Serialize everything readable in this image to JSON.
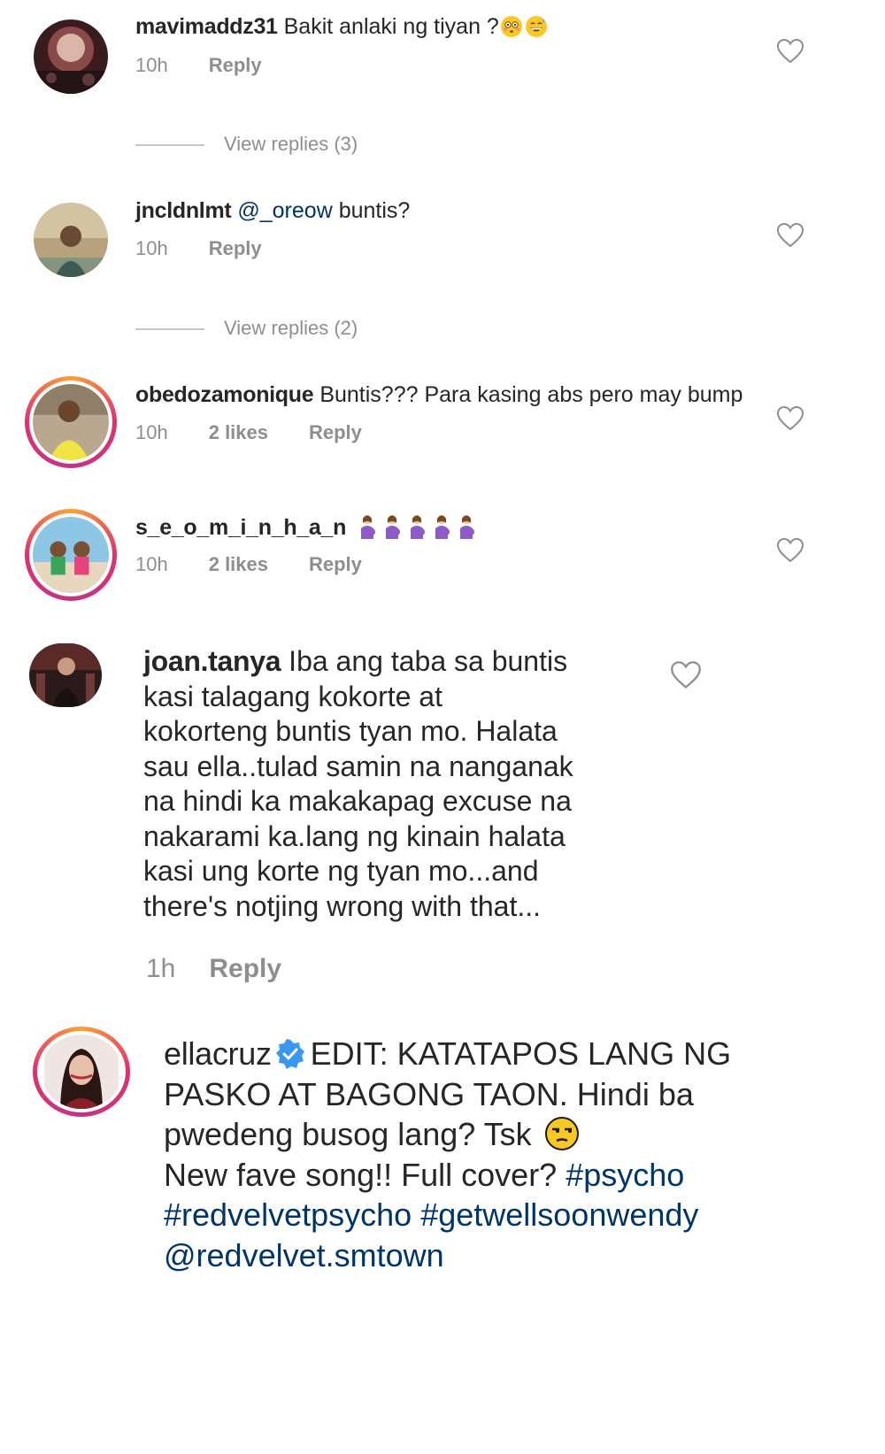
{
  "comments": [
    {
      "username": "mavimaddz31",
      "text": "Bakit anlaki ng tiyan ?",
      "emojis": [
        "flushed-face-emoji",
        "grinning-sweat-emoji"
      ],
      "time": "10h",
      "reply_label": "Reply",
      "view_replies": "View replies (3)"
    },
    {
      "username": "jncldnlmt",
      "mention": "@_oreow",
      "text": "buntis?",
      "time": "10h",
      "reply_label": "Reply",
      "view_replies": "View replies (2)"
    },
    {
      "username": "obedozamonique",
      "text": "Buntis??? Para kasing abs pero may bump",
      "time": "10h",
      "likes": "2 likes",
      "reply_label": "Reply"
    },
    {
      "username": "s_e_o_m_i_n_h_a_n",
      "emojis": [
        "pregnant-woman-emoji",
        "pregnant-woman-emoji",
        "pregnant-woman-emoji",
        "pregnant-woman-emoji",
        "pregnant-woman-emoji"
      ],
      "time": "10h",
      "likes": "2 likes",
      "reply_label": "Reply"
    },
    {
      "username": "joan.tanya",
      "lines": [
        "Iba ang taba sa buntis",
        "kasi talagang kokorte at",
        "kokorteng buntis tyan mo. Halata",
        "sau ella..tulad samin na nanganak",
        "na hindi ka makakapag excuse na",
        "nakarami ka.lang ng kinain halata",
        "kasi ung korte ng tyan mo...and",
        "there's notjing wrong with that..."
      ],
      "time": "1h",
      "reply_label": "Reply"
    }
  ],
  "caption": {
    "username": "ellacruz",
    "verified_icon": "verified-badge-icon",
    "line1": "EDIT: KATATAPOS LANG NG",
    "line2": "PASKO AT BAGONG TAON. Hindi ba",
    "line3": "pwedeng busog lang? Tsk",
    "line3_emoji": "unamused-face-emoji",
    "line4_text": "New fave song!! Full cover?",
    "hashtag1": "#psycho",
    "hashtag2": "#redvelvetpsycho",
    "hashtag3": "#getwellsoonwendy",
    "mention": "@redvelvet.smtown"
  },
  "colors": {
    "text": "#262626",
    "meta": "#8e8e8e",
    "link": "#003569",
    "verified": "#3897f0"
  }
}
